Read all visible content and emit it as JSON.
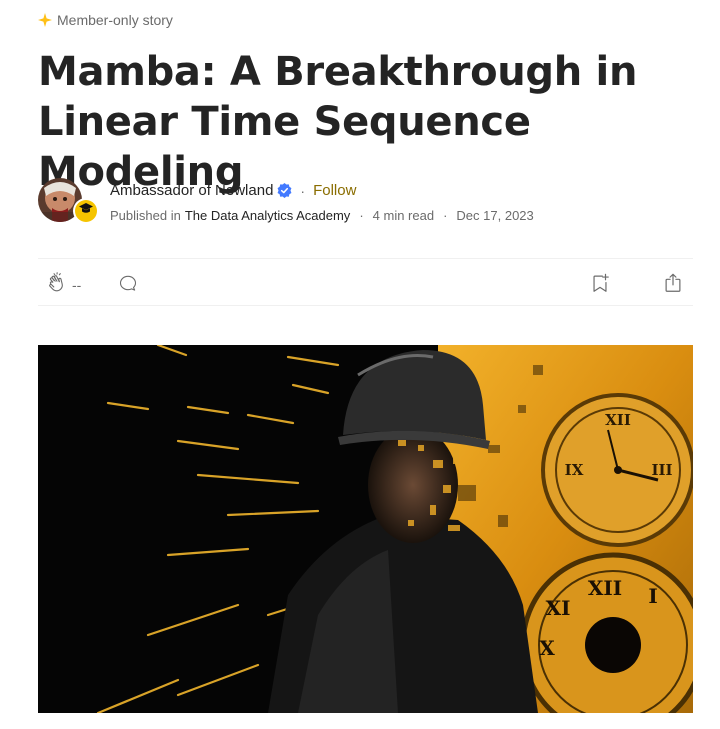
{
  "badge": {
    "label": "Member-only story",
    "icon": "sparkle-icon",
    "color": "#FFC017"
  },
  "article": {
    "title": "Mamba: A Breakthrough in Linear Time Sequence Modeling"
  },
  "author": {
    "name": "Ambassador of Newland",
    "verified_icon": "verified-badge-icon",
    "follow_label": "Follow",
    "separator": "·",
    "follow_color": "#8a6d00"
  },
  "meta": {
    "published_prefix": "Published in",
    "publication": "The Data Analytics Academy",
    "read_time": "4 min read",
    "date": "Dec 17, 2023",
    "separator": "·"
  },
  "actions": {
    "clap_count": "--",
    "clap_icon": "clap-icon",
    "comment_icon": "comment-icon",
    "bookmark_icon": "bookmark-add-icon",
    "share_icon": "share-icon"
  },
  "hero_image": {
    "subject": "helmeted-figure-with-clocks",
    "accent": "#E8A21C"
  }
}
